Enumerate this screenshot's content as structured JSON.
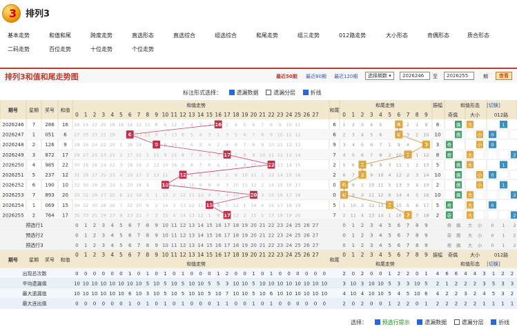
{
  "app": {
    "title": "排列3"
  },
  "nav": [
    "基本走势",
    "和值和尾",
    "跨度走势",
    "直选形态",
    "直选综合",
    "组选综合",
    "和尾走势",
    "组三走势",
    "012路走势",
    "大小形态",
    "奇偶形态",
    "质合形态",
    "二码走势",
    "百位走势",
    "十位走势",
    "个位走势"
  ],
  "section": {
    "title": "排列3和值和尾走势图"
  },
  "periods": {
    "p50": "最近50期",
    "p80": "最近80期",
    "p120": "最近120期"
  },
  "select": {
    "issue": "选择期数",
    "from": "2026246",
    "to_label": "至",
    "to": "2026255",
    "unit": "期",
    "query": "查看"
  },
  "opts": {
    "label": "标注形式选择：",
    "o1": "遗漏数据",
    "o2": "遗漏分层",
    "o3": "折线"
  },
  "opts2": {
    "label": "选择：",
    "o1": "预选行提示",
    "o2": "遗漏数据",
    "o3": "遗漏分层",
    "o4": "折线"
  },
  "headers": {
    "qihao": "期号",
    "xingqi": "星期",
    "jianghao": "奖号",
    "hezhi": "和值",
    "zoushi": "和值走势",
    "hewei": "和尾",
    "hwzs": "和尾走势",
    "xt": "和值形态",
    "qie": "[切换]",
    "zhenfu": "振幅",
    "qiou": "奇偶",
    "daxiao": "大小",
    "lu": "012路"
  },
  "rows": [
    {
      "qh": "2026246",
      "xq": "7",
      "jh": "286",
      "hz": 16,
      "hw": 6,
      "zf": 8,
      "qo": "偶",
      "dx": "大",
      "lu": 1
    },
    {
      "qh": "2026247",
      "xq": "1",
      "jh": "051",
      "hz": 6,
      "hw": 6,
      "zf": 10,
      "qo": "偶",
      "dx": "小",
      "lu": 0
    },
    {
      "qh": "2026248",
      "xq": "2",
      "jh": "126",
      "hz": 9,
      "hw": 9,
      "zf": 3,
      "qo": "奇",
      "dx": "小",
      "lu": 0
    },
    {
      "qh": "2026249",
      "xq": "3",
      "jh": "872",
      "hz": 17,
      "hw": 7,
      "zf": 8,
      "qo": "奇",
      "dx": "大",
      "lu": 2
    },
    {
      "qh": "2026250",
      "xq": "4",
      "jh": "985",
      "hz": 22,
      "hw": 2,
      "zf": 5,
      "qo": "偶",
      "dx": "大",
      "lu": 1
    },
    {
      "qh": "2026251",
      "xq": "5",
      "jh": "237",
      "hz": 12,
      "hw": 2,
      "zf": 10,
      "qo": "偶",
      "dx": "小",
      "lu": 0
    },
    {
      "qh": "2026252",
      "xq": "6",
      "jh": "190",
      "hz": 10,
      "hw": 0,
      "zf": 2,
      "qo": "偶",
      "dx": "小",
      "lu": 1
    },
    {
      "qh": "2026253",
      "xq": "7",
      "jh": "893",
      "hz": 20,
      "hw": 0,
      "zf": 10,
      "qo": "偶",
      "dx": "大",
      "lu": 2
    },
    {
      "qh": "2026254",
      "xq": "1",
      "jh": "069",
      "hz": 15,
      "hw": 5,
      "zf": 5,
      "qo": "奇",
      "dx": "大",
      "lu": 0
    },
    {
      "qh": "2026255",
      "xq": "2",
      "jh": "764",
      "hz": 17,
      "hw": 7,
      "zf": 2,
      "qo": "奇",
      "dx": "大",
      "lu": 2
    }
  ],
  "miss_hz": [
    [
      26,
      24,
      22,
      20,
      18,
      16,
      14,
      12,
      11,
      8,
      6,
      12,
      5,
      4,
      3,
      2,
      "",
      2,
      4,
      5,
      6,
      7,
      8,
      9,
      10,
      11,
      "",
      "",
      ""
    ],
    [
      27,
      25,
      23,
      21,
      19,
      "",
      15,
      13,
      12,
      9,
      7,
      13,
      6,
      5,
      4,
      3,
      1,
      3,
      5,
      6,
      7,
      8,
      9,
      10,
      11,
      12,
      "",
      "",
      ""
    ],
    [
      28,
      26,
      24,
      22,
      20,
      1,
      16,
      14,
      "",
      10,
      8,
      14,
      7,
      6,
      5,
      4,
      2,
      4,
      6,
      7,
      8,
      9,
      10,
      11,
      12,
      13,
      "",
      "",
      ""
    ],
    [
      29,
      27,
      25,
      23,
      21,
      2,
      17,
      15,
      1,
      11,
      9,
      15,
      8,
      7,
      6,
      5,
      3,
      "",
      7,
      8,
      9,
      10,
      11,
      12,
      13,
      14,
      "",
      "",
      ""
    ],
    [
      30,
      28,
      26,
      24,
      22,
      3,
      18,
      16,
      2,
      12,
      10,
      16,
      9,
      8,
      7,
      6,
      4,
      1,
      8,
      9,
      10,
      "",
      12,
      13,
      14,
      15,
      "",
      "",
      ""
    ],
    [
      31,
      29,
      27,
      25,
      23,
      4,
      19,
      17,
      3,
      13,
      11,
      "",
      10,
      9,
      8,
      7,
      5,
      2,
      9,
      10,
      11,
      1,
      13,
      14,
      15,
      16,
      "",
      "",
      ""
    ],
    [
      32,
      30,
      28,
      26,
      24,
      5,
      20,
      18,
      4,
      "",
      12,
      1,
      11,
      10,
      9,
      8,
      6,
      3,
      10,
      11,
      12,
      2,
      14,
      15,
      16,
      17,
      "",
      "",
      ""
    ],
    [
      33,
      31,
      29,
      27,
      25,
      6,
      21,
      19,
      5,
      1,
      13,
      2,
      12,
      11,
      10,
      9,
      7,
      4,
      10,
      "",
      13,
      3,
      15,
      16,
      17,
      18,
      "",
      "",
      ""
    ],
    [
      34,
      32,
      30,
      28,
      26,
      7,
      22,
      20,
      6,
      2,
      14,
      3,
      13,
      12,
      11,
      "",
      8,
      5,
      11,
      1,
      14,
      4,
      16,
      17,
      18,
      19,
      "",
      "",
      ""
    ],
    [
      35,
      33,
      31,
      29,
      27,
      8,
      23,
      21,
      7,
      3,
      15,
      4,
      14,
      13,
      12,
      1,
      9,
      "",
      12,
      2,
      15,
      5,
      17,
      18,
      19,
      20,
      "",
      "",
      ""
    ]
  ],
  "miss_hw": [
    [
      1,
      2,
      3,
      4,
      5,
      "",
      7,
      2,
      1,
      9
    ],
    [
      2,
      3,
      4,
      5,
      6,
      "",
      8,
      3,
      2,
      10
    ],
    [
      3,
      4,
      5,
      6,
      7,
      1,
      9,
      4,
      "",
      11
    ],
    [
      4,
      5,
      6,
      7,
      8,
      2,
      10,
      "",
      1,
      12
    ],
    [
      5,
      6,
      "",
      8,
      9,
      3,
      11,
      1,
      2,
      13
    ],
    [
      6,
      7,
      "",
      9,
      10,
      4,
      12,
      2,
      3,
      14
    ],
    [
      "",
      8,
      1,
      10,
      11,
      5,
      13,
      3,
      4,
      15
    ],
    [
      "",
      9,
      2,
      11,
      12,
      6,
      14,
      4,
      5,
      16
    ],
    [
      1,
      10,
      3,
      12,
      13,
      "",
      15,
      5,
      6,
      17
    ],
    [
      2,
      11,
      4,
      13,
      14,
      1,
      16,
      "",
      7,
      18
    ]
  ],
  "pre_rows": [
    "预选行1",
    "预选行2",
    "预选行3"
  ],
  "stat_rows": [
    {
      "name": "出现总次数",
      "hz": [
        0,
        0,
        0,
        0,
        0,
        0,
        1,
        0,
        1,
        0,
        1,
        0,
        1,
        0,
        0,
        0,
        1,
        2,
        0,
        0,
        1,
        0,
        1,
        0,
        0,
        0,
        0,
        0,
        0
      ],
      "hw": [
        2,
        0,
        2,
        0,
        0,
        1,
        2,
        2,
        0,
        1
      ],
      "xt": [
        4,
        6,
        6,
        4,
        4,
        3,
        1,
        2,
        2
      ]
    },
    {
      "name": "平均遗漏值",
      "hz": [
        10,
        10,
        10,
        10,
        10,
        10,
        10,
        10,
        5,
        10,
        5,
        10,
        5,
        10,
        10,
        5,
        5,
        3,
        10,
        10,
        5,
        10,
        10,
        10,
        10,
        10,
        10,
        10,
        10
      ],
      "hw": [
        3,
        10,
        3,
        10,
        10,
        5,
        3,
        3,
        10,
        5
      ],
      "xt": [
        2,
        1,
        2,
        2,
        2,
        3,
        5,
        3,
        3
      ]
    },
    {
      "name": "最大遗漏值",
      "hz": [
        10,
        10,
        10,
        10,
        10,
        10,
        6,
        10,
        3,
        10,
        5,
        10,
        5,
        10,
        10,
        5,
        10,
        7,
        10,
        10,
        5,
        10,
        6,
        10,
        10,
        10,
        10,
        10,
        10
      ],
      "hw": [
        4,
        10,
        4,
        10,
        10,
        5,
        4,
        5,
        10,
        6
      ],
      "xt": [
        4,
        2,
        2,
        3,
        2,
        4,
        5,
        3,
        2
      ]
    },
    {
      "name": "最大连出值",
      "hz": [
        0,
        0,
        0,
        0,
        0,
        0,
        1,
        0,
        1,
        0,
        1,
        0,
        1,
        0,
        0,
        0,
        1,
        1,
        0,
        0,
        1,
        0,
        1,
        0,
        0,
        0,
        0,
        0,
        0
      ],
      "hw": [
        2,
        0,
        2,
        0,
        0,
        1,
        2,
        2,
        0,
        1
      ],
      "xt": [
        2,
        2,
        2,
        2,
        2,
        1,
        1,
        1,
        1
      ]
    }
  ]
}
